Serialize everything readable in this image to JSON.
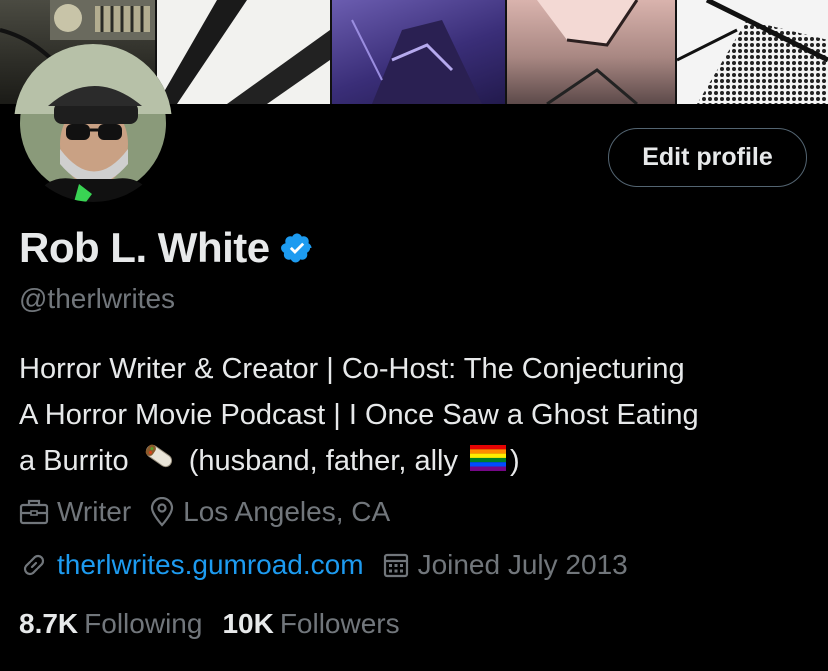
{
  "profile": {
    "name": "Rob L. White",
    "handle": "@therlwrites",
    "bio": {
      "line1": "Horror Writer & Creator | Co-Host: The Conjecturing",
      "line2": "A Horror Movie Podcast | I Once Saw a Ghost Eating",
      "line3_a": "a Burrito",
      "line3_b": "(husband, father, ally",
      "line3_c": ")"
    },
    "edit_button": "Edit profile"
  },
  "meta": {
    "profession": "Writer",
    "location": "Los Angeles, CA",
    "website": "therlwrites.gumroad.com",
    "joined": "Joined July 2013"
  },
  "stats": {
    "following_count": "8.7K",
    "following_label": "Following",
    "followers_count": "10K",
    "followers_label": "Followers"
  },
  "icons": {
    "verified": "verified-badge-icon",
    "profession": "briefcase-icon",
    "location": "location-pin-icon",
    "website": "link-icon",
    "joined": "calendar-icon",
    "burrito": "burrito-emoji",
    "pride": "rainbow-flag-emoji"
  },
  "colors": {
    "background": "#000000",
    "text_primary": "#e7e9ea",
    "text_secondary": "#71767b",
    "link": "#1d9bf0",
    "verified": "#1d9bf0"
  }
}
